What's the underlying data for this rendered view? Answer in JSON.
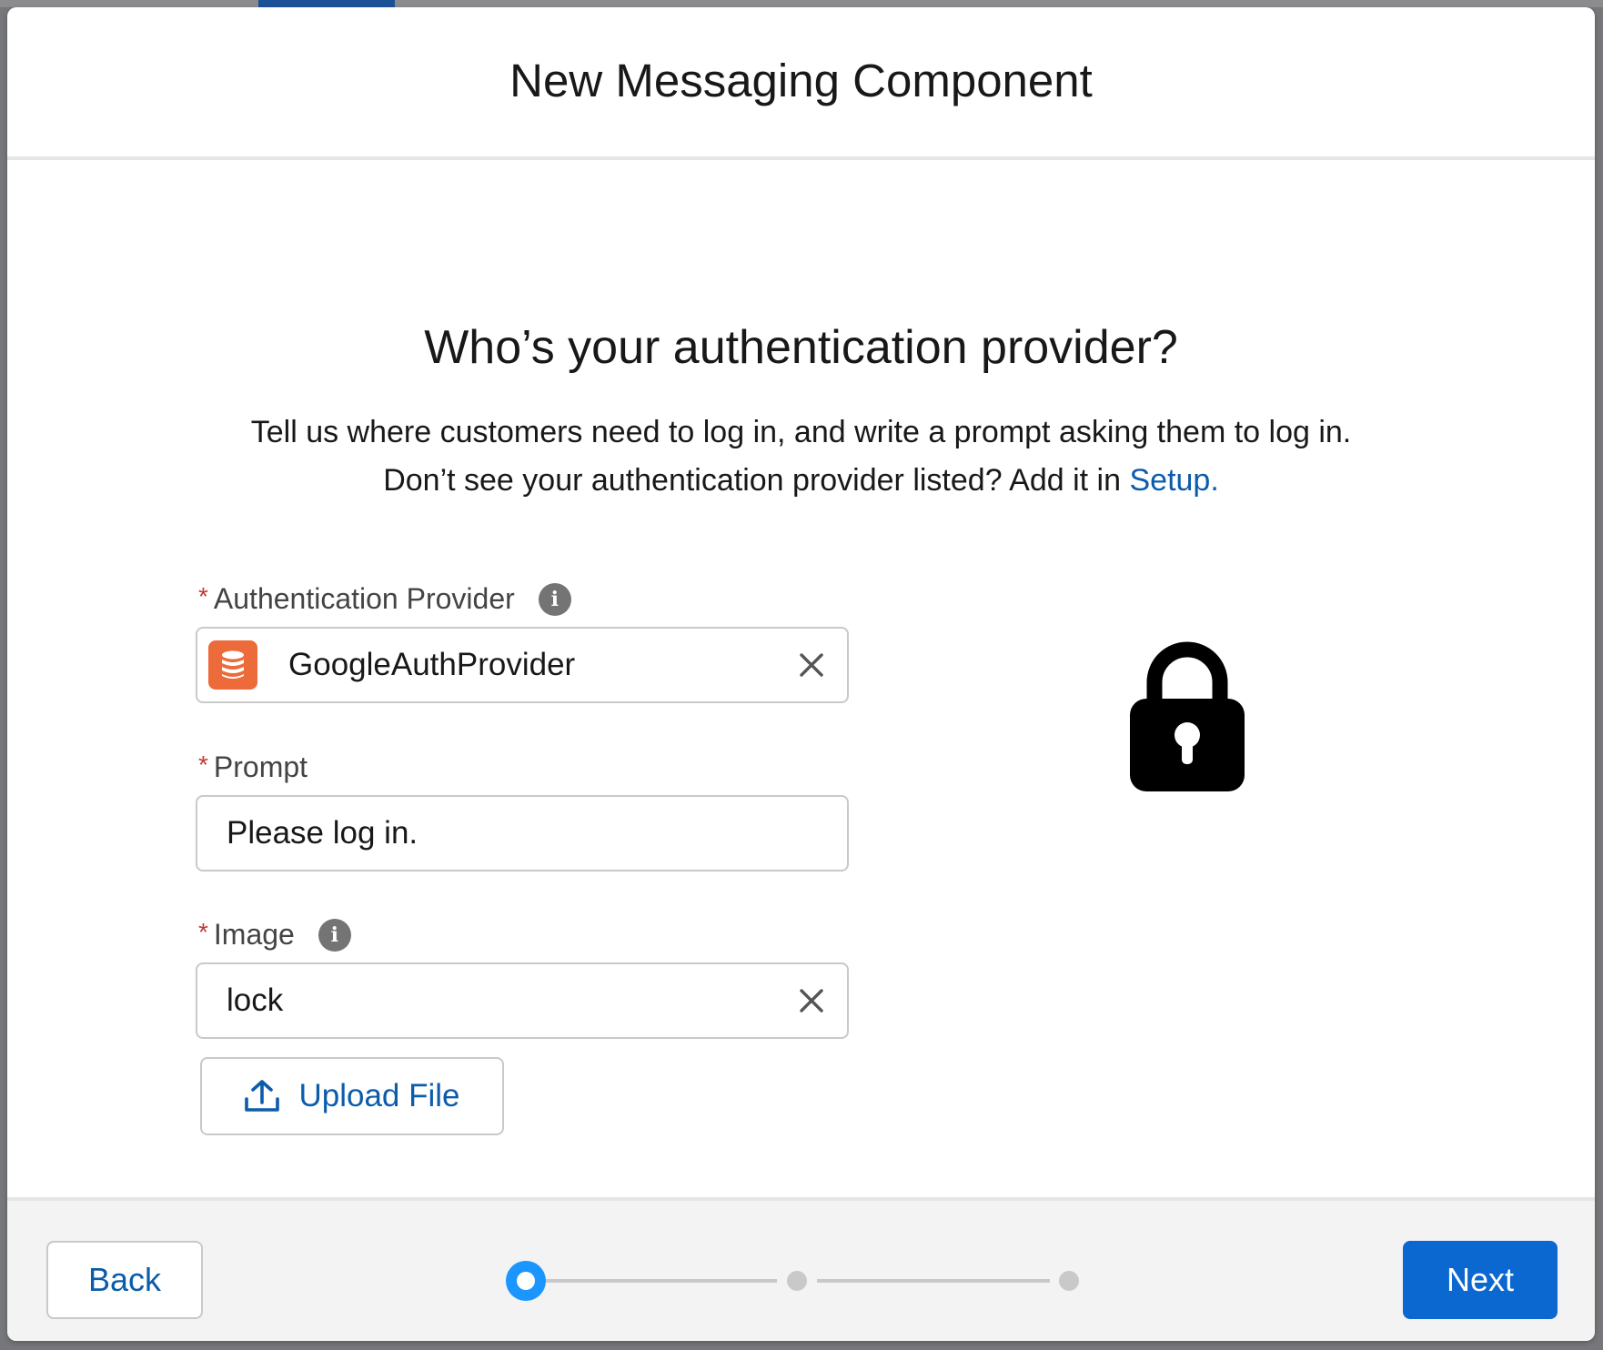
{
  "modal": {
    "title": "New Messaging Component"
  },
  "content": {
    "heading": "Who’s your authentication provider?",
    "description_line1": "Tell us where customers need to log in, and write a prompt asking them to log in.",
    "description_line2_prefix": "Don’t see your authentication provider listed? Add it in ",
    "setup_link": "Setup."
  },
  "form": {
    "auth_provider": {
      "required_marker": "*",
      "label": "Authentication Provider",
      "value": "GoogleAuthProvider",
      "icon": "database-icon"
    },
    "prompt": {
      "required_marker": "*",
      "label": "Prompt",
      "value": "Please log in."
    },
    "image": {
      "required_marker": "*",
      "label": "Image",
      "value": "lock"
    },
    "upload_button": "Upload File"
  },
  "preview": {
    "icon": "lock-icon"
  },
  "footer": {
    "back_label": "Back",
    "next_label": "Next",
    "progress": {
      "current_step": 1,
      "total_steps": 3
    }
  },
  "colors": {
    "link": "#0b5cab",
    "primary_button": "#0b68d0",
    "provider_icon": "#ed6b3a",
    "required": "#c23934",
    "progress_active": "#1b96ff"
  }
}
